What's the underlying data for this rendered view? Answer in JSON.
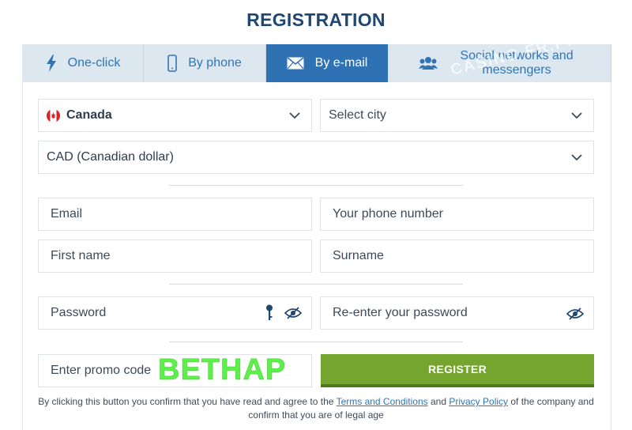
{
  "page": {
    "title": "REGISTRATION",
    "watermark": "CASINO FR.PRO"
  },
  "tabs": [
    {
      "label": "One-click",
      "icon": "lightning-icon"
    },
    {
      "label": "By phone",
      "icon": "phone-icon"
    },
    {
      "label": "By e-mail",
      "icon": "envelope-icon",
      "active": true
    },
    {
      "label": "Social networks and messengers",
      "icon": "users-icon"
    }
  ],
  "location": {
    "country": "Canada",
    "city_placeholder": "Select city",
    "currency": "CAD (Canadian dollar)"
  },
  "contact": {
    "email_placeholder": "Email",
    "phone_placeholder": "Your phone number"
  },
  "name": {
    "first_placeholder": "First name",
    "surname_placeholder": "Surname"
  },
  "password": {
    "password_placeholder": "Password",
    "reenter_placeholder": "Re-enter your password"
  },
  "promo": {
    "placeholder": "Enter promo code",
    "value": "BETHAP"
  },
  "register": {
    "label": "REGISTER"
  },
  "legal": {
    "prefix": "By clicking this button you confirm that you have read and agree to the",
    "terms_link": "Terms and Conditions",
    "and": "and",
    "privacy_link": "Privacy Policy",
    "suffix": "of the company and confirm that you are of legal age"
  },
  "colors": {
    "accent": "#2f72b4",
    "register": "#75a52e",
    "promo_text": "#5df04a",
    "title": "#1f4771"
  }
}
